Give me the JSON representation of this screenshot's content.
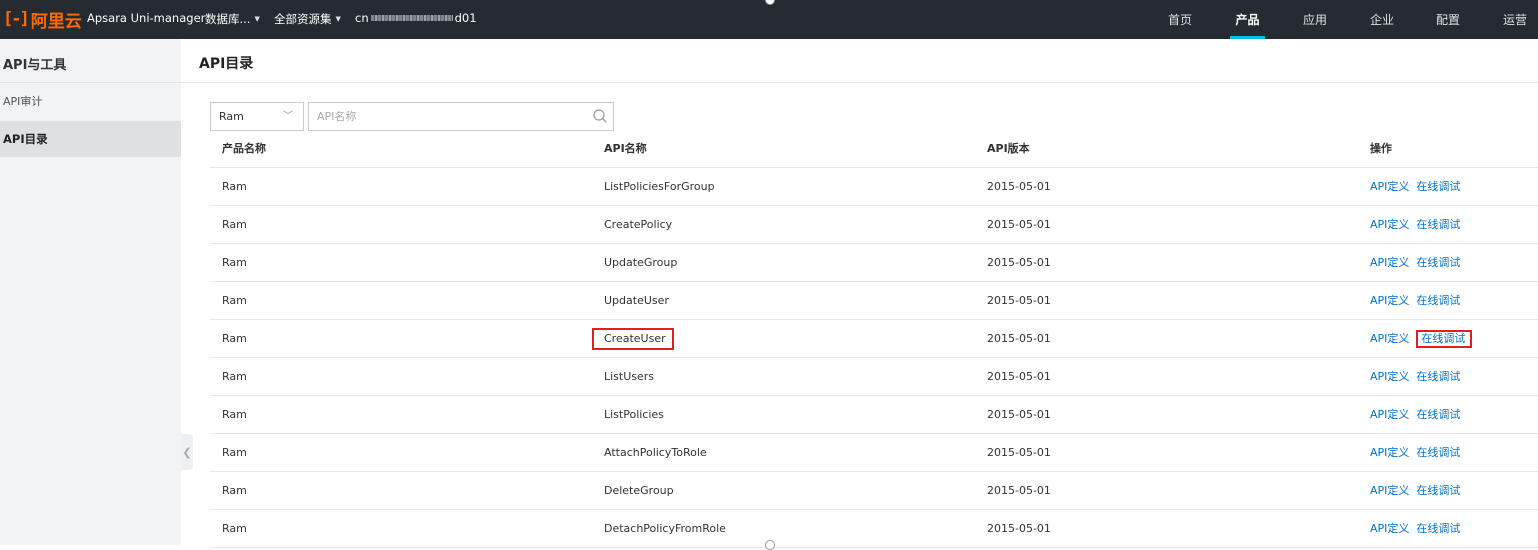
{
  "topbar": {
    "logo_mark": "[-]",
    "logo_text": "阿里云",
    "product_name": "Apsara Uni-manager",
    "db_dropdown": "数据库...",
    "resource_set": "全部资源集",
    "region_prefix": "cn",
    "region_suffix": "d01",
    "nav": [
      "首页",
      "产品",
      "应用",
      "企业",
      "配置",
      "运营"
    ],
    "active_nav": "产品",
    "accent_color": "#00c1de",
    "logo_color": "#ff6a00"
  },
  "sidebar": {
    "title": "API与工具",
    "items": [
      {
        "label": "API审计",
        "active": false
      },
      {
        "label": "API目录",
        "active": true
      }
    ]
  },
  "main": {
    "title": "API目录",
    "filter": {
      "select_value": "Ram",
      "search_placeholder": "API名称"
    },
    "table": {
      "headers": [
        "产品名称",
        "API名称",
        "API版本",
        "操作"
      ],
      "rows": [
        {
          "product": "Ram",
          "api": "ListPoliciesForGroup",
          "version": "2015-05-01"
        },
        {
          "product": "Ram",
          "api": "CreatePolicy",
          "version": "2015-05-01"
        },
        {
          "product": "Ram",
          "api": "UpdateGroup",
          "version": "2015-05-01"
        },
        {
          "product": "Ram",
          "api": "UpdateUser",
          "version": "2015-05-01"
        },
        {
          "product": "Ram",
          "api": "CreateUser",
          "version": "2015-05-01"
        },
        {
          "product": "Ram",
          "api": "ListUsers",
          "version": "2015-05-01"
        },
        {
          "product": "Ram",
          "api": "ListPolicies",
          "version": "2015-05-01"
        },
        {
          "product": "Ram",
          "api": "AttachPolicyToRole",
          "version": "2015-05-01"
        },
        {
          "product": "Ram",
          "api": "DeleteGroup",
          "version": "2015-05-01"
        },
        {
          "product": "Ram",
          "api": "DetachPolicyFromRole",
          "version": "2015-05-01"
        }
      ],
      "action_define": "API定义",
      "action_debug": "在线调试",
      "highlight_color": "#e02020"
    }
  }
}
